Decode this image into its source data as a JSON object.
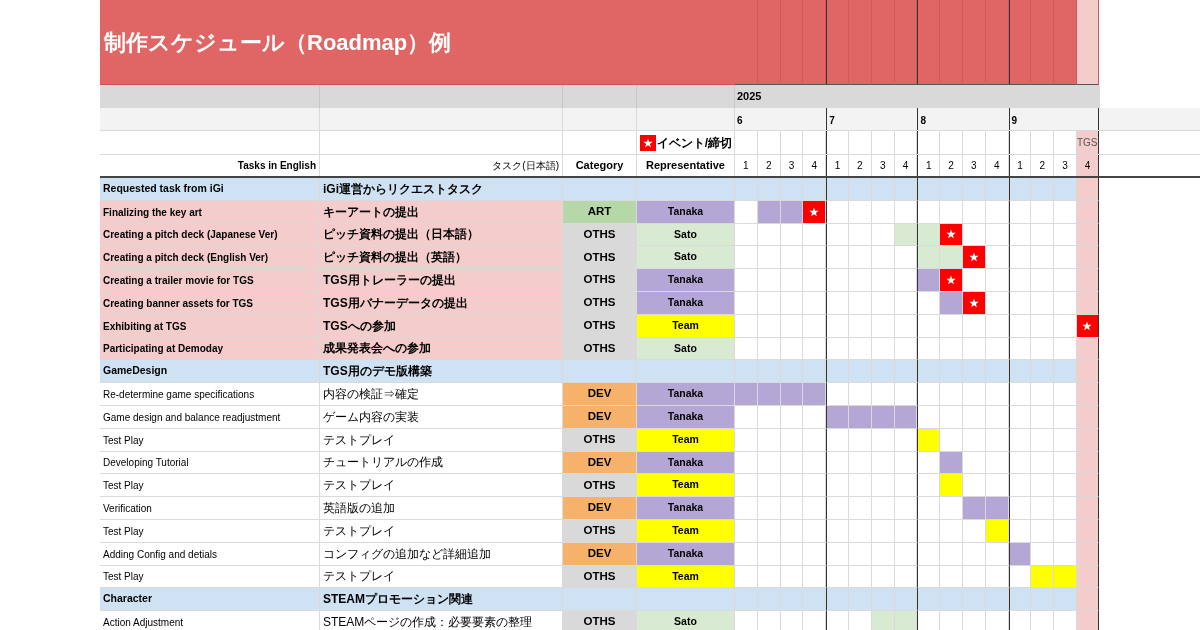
{
  "title": "制作スケジュール（Roadmap）例",
  "year": "2025",
  "legend": {
    "label": "イベント/締切"
  },
  "headers": {
    "english": "Tasks in English",
    "japanese": "タスク(日本語)",
    "category": "Category",
    "representative": "Representative"
  },
  "months": [
    {
      "label": "6",
      "weeks": [
        {
          "label": "1",
          "highlight": false
        },
        {
          "label": "2",
          "highlight": false
        },
        {
          "label": "3",
          "highlight": false
        },
        {
          "label": "4",
          "highlight": false
        }
      ]
    },
    {
      "label": "7",
      "weeks": [
        {
          "label": "1",
          "highlight": false
        },
        {
          "label": "2",
          "highlight": false
        },
        {
          "label": "3",
          "highlight": false
        },
        {
          "label": "4",
          "highlight": false
        }
      ]
    },
    {
      "label": "8",
      "weeks": [
        {
          "label": "1",
          "highlight": false
        },
        {
          "label": "2",
          "highlight": false
        },
        {
          "label": "3",
          "highlight": false
        },
        {
          "label": "4",
          "highlight": false
        }
      ]
    },
    {
      "label": "9",
      "weeks": [
        {
          "label": "1",
          "highlight": false
        },
        {
          "label": "2",
          "highlight": false
        },
        {
          "label": "3",
          "highlight": false
        },
        {
          "label": "4",
          "highlight": true,
          "note": "TGS"
        }
      ]
    }
  ],
  "rows": [
    {
      "kind": "section",
      "english": "Requested task from iGi",
      "japanese": "iGi運営からリクエストタスク",
      "cells": [
        {
          "kind": "none"
        },
        {
          "kind": "none"
        },
        {
          "kind": "none"
        },
        {
          "kind": "none"
        },
        {
          "kind": "none"
        },
        {
          "kind": "none"
        },
        {
          "kind": "none"
        },
        {
          "kind": "none"
        },
        {
          "kind": "none"
        },
        {
          "kind": "none"
        },
        {
          "kind": "none"
        },
        {
          "kind": "none"
        },
        {
          "kind": "none"
        },
        {
          "kind": "none"
        },
        {
          "kind": "none"
        },
        {
          "kind": "none"
        }
      ]
    },
    {
      "kind": "request",
      "english": "Finalizing the key art",
      "japanese": "キーアートの提出",
      "category": {
        "label": "ART",
        "color": "#b6d7a8"
      },
      "representative": {
        "label": "Tanaka",
        "color": "#b4a7d6"
      },
      "cells": [
        {
          "kind": "none"
        },
        {
          "kind": "fill"
        },
        {
          "kind": "fill"
        },
        {
          "kind": "star"
        },
        {
          "kind": "none"
        },
        {
          "kind": "none"
        },
        {
          "kind": "none"
        },
        {
          "kind": "none"
        },
        {
          "kind": "none"
        },
        {
          "kind": "none"
        },
        {
          "kind": "none"
        },
        {
          "kind": "none"
        },
        {
          "kind": "none"
        },
        {
          "kind": "none"
        },
        {
          "kind": "none"
        },
        {
          "kind": "none"
        }
      ]
    },
    {
      "kind": "request",
      "english": "Creating a pitch deck (Japanese Ver)",
      "japanese": "ピッチ資料の提出（日本語）",
      "category": {
        "label": "OTHS",
        "color": "#d9d9d9"
      },
      "representative": {
        "label": "Sato",
        "color": "#d9ead3"
      },
      "cells": [
        {
          "kind": "none"
        },
        {
          "kind": "none"
        },
        {
          "kind": "none"
        },
        {
          "kind": "none"
        },
        {
          "kind": "none"
        },
        {
          "kind": "none"
        },
        {
          "kind": "none"
        },
        {
          "kind": "fill"
        },
        {
          "kind": "fill"
        },
        {
          "kind": "star"
        },
        {
          "kind": "none"
        },
        {
          "kind": "none"
        },
        {
          "kind": "none"
        },
        {
          "kind": "none"
        },
        {
          "kind": "none"
        },
        {
          "kind": "none"
        }
      ]
    },
    {
      "kind": "request",
      "english": "Creating a pitch deck (English Ver)",
      "japanese": "ピッチ資料の提出（英語）",
      "category": {
        "label": "OTHS",
        "color": "#d9d9d9"
      },
      "representative": {
        "label": "Sato",
        "color": "#d9ead3"
      },
      "cells": [
        {
          "kind": "none"
        },
        {
          "kind": "none"
        },
        {
          "kind": "none"
        },
        {
          "kind": "none"
        },
        {
          "kind": "none"
        },
        {
          "kind": "none"
        },
        {
          "kind": "none"
        },
        {
          "kind": "none"
        },
        {
          "kind": "fill"
        },
        {
          "kind": "fill"
        },
        {
          "kind": "star"
        },
        {
          "kind": "none"
        },
        {
          "kind": "none"
        },
        {
          "kind": "none"
        },
        {
          "kind": "none"
        },
        {
          "kind": "none"
        }
      ]
    },
    {
      "kind": "request",
      "english": "Creating a trailer movie  for TGS",
      "japanese": "TGS用トレーラーの提出",
      "category": {
        "label": "OTHS",
        "color": "#d9d9d9"
      },
      "representative": {
        "label": "Tanaka",
        "color": "#b4a7d6"
      },
      "cells": [
        {
          "kind": "none"
        },
        {
          "kind": "none"
        },
        {
          "kind": "none"
        },
        {
          "kind": "none"
        },
        {
          "kind": "none"
        },
        {
          "kind": "none"
        },
        {
          "kind": "none"
        },
        {
          "kind": "none"
        },
        {
          "kind": "fill"
        },
        {
          "kind": "star"
        },
        {
          "kind": "none"
        },
        {
          "kind": "none"
        },
        {
          "kind": "none"
        },
        {
          "kind": "none"
        },
        {
          "kind": "none"
        },
        {
          "kind": "none"
        }
      ]
    },
    {
      "kind": "request",
      "english": "Creating banner assets for TGS",
      "japanese": "TGS用バナーデータの提出",
      "category": {
        "label": "OTHS",
        "color": "#d9d9d9"
      },
      "representative": {
        "label": "Tanaka",
        "color": "#b4a7d6"
      },
      "cells": [
        {
          "kind": "none"
        },
        {
          "kind": "none"
        },
        {
          "kind": "none"
        },
        {
          "kind": "none"
        },
        {
          "kind": "none"
        },
        {
          "kind": "none"
        },
        {
          "kind": "none"
        },
        {
          "kind": "none"
        },
        {
          "kind": "none"
        },
        {
          "kind": "fill"
        },
        {
          "kind": "star"
        },
        {
          "kind": "none"
        },
        {
          "kind": "none"
        },
        {
          "kind": "none"
        },
        {
          "kind": "none"
        },
        {
          "kind": "none"
        }
      ]
    },
    {
      "kind": "request",
      "english": "Exhibiting at TGS",
      "japanese": "TGSへの参加",
      "category": {
        "label": "OTHS",
        "color": "#d9d9d9"
      },
      "representative": {
        "label": "Team",
        "color": "#ffff00"
      },
      "cells": [
        {
          "kind": "none"
        },
        {
          "kind": "none"
        },
        {
          "kind": "none"
        },
        {
          "kind": "none"
        },
        {
          "kind": "none"
        },
        {
          "kind": "none"
        },
        {
          "kind": "none"
        },
        {
          "kind": "none"
        },
        {
          "kind": "none"
        },
        {
          "kind": "none"
        },
        {
          "kind": "none"
        },
        {
          "kind": "none"
        },
        {
          "kind": "none"
        },
        {
          "kind": "none"
        },
        {
          "kind": "none"
        },
        {
          "kind": "star"
        }
      ]
    },
    {
      "kind": "request",
      "english": "Participating at Demoday",
      "japanese": "成果発表会への参加",
      "category": {
        "label": "OTHS",
        "color": "#d9d9d9"
      },
      "representative": {
        "label": "Sato",
        "color": "#d9ead3"
      },
      "cells": [
        {
          "kind": "none"
        },
        {
          "kind": "none"
        },
        {
          "kind": "none"
        },
        {
          "kind": "none"
        },
        {
          "kind": "none"
        },
        {
          "kind": "none"
        },
        {
          "kind": "none"
        },
        {
          "kind": "none"
        },
        {
          "kind": "none"
        },
        {
          "kind": "none"
        },
        {
          "kind": "none"
        },
        {
          "kind": "none"
        },
        {
          "kind": "none"
        },
        {
          "kind": "none"
        },
        {
          "kind": "none"
        },
        {
          "kind": "none"
        }
      ]
    },
    {
      "kind": "section",
      "english": "GameDesign",
      "japanese": "TGS用のデモ版構築",
      "cells": [
        {
          "kind": "none"
        },
        {
          "kind": "none"
        },
        {
          "kind": "none"
        },
        {
          "kind": "none"
        },
        {
          "kind": "none"
        },
        {
          "kind": "none"
        },
        {
          "kind": "none"
        },
        {
          "kind": "none"
        },
        {
          "kind": "none"
        },
        {
          "kind": "none"
        },
        {
          "kind": "none"
        },
        {
          "kind": "none"
        },
        {
          "kind": "none"
        },
        {
          "kind": "none"
        },
        {
          "kind": "none"
        },
        {
          "kind": "none"
        }
      ]
    },
    {
      "kind": "task",
      "english": "Re-determine game specifications",
      "japanese": "内容の検証⇒確定",
      "category": {
        "label": "DEV",
        "color": "#f6b26b"
      },
      "representative": {
        "label": "Tanaka",
        "color": "#b4a7d6"
      },
      "cells": [
        {
          "kind": "fill"
        },
        {
          "kind": "fill"
        },
        {
          "kind": "fill"
        },
        {
          "kind": "fill"
        },
        {
          "kind": "none"
        },
        {
          "kind": "none"
        },
        {
          "kind": "none"
        },
        {
          "kind": "none"
        },
        {
          "kind": "none"
        },
        {
          "kind": "none"
        },
        {
          "kind": "none"
        },
        {
          "kind": "none"
        },
        {
          "kind": "none"
        },
        {
          "kind": "none"
        },
        {
          "kind": "none"
        },
        {
          "kind": "none"
        }
      ]
    },
    {
      "kind": "task",
      "english": "Game design and balance readjustment",
      "japanese": "ゲーム内容の実装",
      "category": {
        "label": "DEV",
        "color": "#f6b26b"
      },
      "representative": {
        "label": "Tanaka",
        "color": "#b4a7d6"
      },
      "cells": [
        {
          "kind": "none"
        },
        {
          "kind": "none"
        },
        {
          "kind": "none"
        },
        {
          "kind": "none"
        },
        {
          "kind": "fill"
        },
        {
          "kind": "fill"
        },
        {
          "kind": "fill"
        },
        {
          "kind": "fill"
        },
        {
          "kind": "none"
        },
        {
          "kind": "none"
        },
        {
          "kind": "none"
        },
        {
          "kind": "none"
        },
        {
          "kind": "none"
        },
        {
          "kind": "none"
        },
        {
          "kind": "none"
        },
        {
          "kind": "none"
        }
      ]
    },
    {
      "kind": "task",
      "english": "Test Play",
      "japanese": "テストプレイ",
      "category": {
        "label": "OTHS",
        "color": "#d9d9d9"
      },
      "representative": {
        "label": "Team",
        "color": "#ffff00"
      },
      "cells": [
        {
          "kind": "none"
        },
        {
          "kind": "none"
        },
        {
          "kind": "none"
        },
        {
          "kind": "none"
        },
        {
          "kind": "none"
        },
        {
          "kind": "none"
        },
        {
          "kind": "none"
        },
        {
          "kind": "none"
        },
        {
          "kind": "fill"
        },
        {
          "kind": "none"
        },
        {
          "kind": "none"
        },
        {
          "kind": "none"
        },
        {
          "kind": "none"
        },
        {
          "kind": "none"
        },
        {
          "kind": "none"
        },
        {
          "kind": "none"
        }
      ]
    },
    {
      "kind": "task",
      "english": "Developing Tutorial",
      "japanese": "チュートリアルの作成",
      "category": {
        "label": "DEV",
        "color": "#f6b26b"
      },
      "representative": {
        "label": "Tanaka",
        "color": "#b4a7d6"
      },
      "cells": [
        {
          "kind": "none"
        },
        {
          "kind": "none"
        },
        {
          "kind": "none"
        },
        {
          "kind": "none"
        },
        {
          "kind": "none"
        },
        {
          "kind": "none"
        },
        {
          "kind": "none"
        },
        {
          "kind": "none"
        },
        {
          "kind": "none"
        },
        {
          "kind": "fill"
        },
        {
          "kind": "none"
        },
        {
          "kind": "none"
        },
        {
          "kind": "none"
        },
        {
          "kind": "none"
        },
        {
          "kind": "none"
        },
        {
          "kind": "none"
        }
      ]
    },
    {
      "kind": "task",
      "english": "Test Play",
      "japanese": "テストプレイ",
      "category": {
        "label": "OTHS",
        "color": "#d9d9d9"
      },
      "representative": {
        "label": "Team",
        "color": "#ffff00"
      },
      "cells": [
        {
          "kind": "none"
        },
        {
          "kind": "none"
        },
        {
          "kind": "none"
        },
        {
          "kind": "none"
        },
        {
          "kind": "none"
        },
        {
          "kind": "none"
        },
        {
          "kind": "none"
        },
        {
          "kind": "none"
        },
        {
          "kind": "none"
        },
        {
          "kind": "fill"
        },
        {
          "kind": "none"
        },
        {
          "kind": "none"
        },
        {
          "kind": "none"
        },
        {
          "kind": "none"
        },
        {
          "kind": "none"
        },
        {
          "kind": "none"
        }
      ]
    },
    {
      "kind": "task",
      "english": "Verification",
      "japanese": "英語版の追加",
      "category": {
        "label": "DEV",
        "color": "#f6b26b"
      },
      "representative": {
        "label": "Tanaka",
        "color": "#b4a7d6"
      },
      "cells": [
        {
          "kind": "none"
        },
        {
          "kind": "none"
        },
        {
          "kind": "none"
        },
        {
          "kind": "none"
        },
        {
          "kind": "none"
        },
        {
          "kind": "none"
        },
        {
          "kind": "none"
        },
        {
          "kind": "none"
        },
        {
          "kind": "none"
        },
        {
          "kind": "none"
        },
        {
          "kind": "fill"
        },
        {
          "kind": "fill"
        },
        {
          "kind": "none"
        },
        {
          "kind": "none"
        },
        {
          "kind": "none"
        },
        {
          "kind": "none"
        }
      ]
    },
    {
      "kind": "task",
      "english": "Test Play",
      "japanese": "テストプレイ",
      "category": {
        "label": "OTHS",
        "color": "#d9d9d9"
      },
      "representative": {
        "label": "Team",
        "color": "#ffff00"
      },
      "cells": [
        {
          "kind": "none"
        },
        {
          "kind": "none"
        },
        {
          "kind": "none"
        },
        {
          "kind": "none"
        },
        {
          "kind": "none"
        },
        {
          "kind": "none"
        },
        {
          "kind": "none"
        },
        {
          "kind": "none"
        },
        {
          "kind": "none"
        },
        {
          "kind": "none"
        },
        {
          "kind": "none"
        },
        {
          "kind": "fill"
        },
        {
          "kind": "none"
        },
        {
          "kind": "none"
        },
        {
          "kind": "none"
        },
        {
          "kind": "none"
        }
      ]
    },
    {
      "kind": "task",
      "english": "Adding Config and detials",
      "japanese": "コンフィグの追加など詳細追加",
      "category": {
        "label": "DEV",
        "color": "#f6b26b"
      },
      "representative": {
        "label": "Tanaka",
        "color": "#b4a7d6"
      },
      "cells": [
        {
          "kind": "none"
        },
        {
          "kind": "none"
        },
        {
          "kind": "none"
        },
        {
          "kind": "none"
        },
        {
          "kind": "none"
        },
        {
          "kind": "none"
        },
        {
          "kind": "none"
        },
        {
          "kind": "none"
        },
        {
          "kind": "none"
        },
        {
          "kind": "none"
        },
        {
          "kind": "none"
        },
        {
          "kind": "none"
        },
        {
          "kind": "fill"
        },
        {
          "kind": "none"
        },
        {
          "kind": "none"
        },
        {
          "kind": "none"
        }
      ]
    },
    {
      "kind": "task",
      "english": "Test Play",
      "japanese": "テストプレイ",
      "category": {
        "label": "OTHS",
        "color": "#d9d9d9"
      },
      "representative": {
        "label": "Team",
        "color": "#ffff00"
      },
      "cells": [
        {
          "kind": "none"
        },
        {
          "kind": "none"
        },
        {
          "kind": "none"
        },
        {
          "kind": "none"
        },
        {
          "kind": "none"
        },
        {
          "kind": "none"
        },
        {
          "kind": "none"
        },
        {
          "kind": "none"
        },
        {
          "kind": "none"
        },
        {
          "kind": "none"
        },
        {
          "kind": "none"
        },
        {
          "kind": "none"
        },
        {
          "kind": "none"
        },
        {
          "kind": "fill"
        },
        {
          "kind": "fill"
        },
        {
          "kind": "none"
        }
      ]
    },
    {
      "kind": "section",
      "english": "Character",
      "japanese": "STEAMプロモーション関連",
      "cells": [
        {
          "kind": "none"
        },
        {
          "kind": "none"
        },
        {
          "kind": "none"
        },
        {
          "kind": "none"
        },
        {
          "kind": "none"
        },
        {
          "kind": "none"
        },
        {
          "kind": "none"
        },
        {
          "kind": "none"
        },
        {
          "kind": "none"
        },
        {
          "kind": "none"
        },
        {
          "kind": "none"
        },
        {
          "kind": "none"
        },
        {
          "kind": "none"
        },
        {
          "kind": "none"
        },
        {
          "kind": "none"
        },
        {
          "kind": "none"
        }
      ]
    },
    {
      "kind": "task",
      "english": "Action Adjustment",
      "japanese": "STEAMページの作成：必要要素の整理",
      "category": {
        "label": "OTHS",
        "color": "#d9d9d9"
      },
      "representative": {
        "label": "Sato",
        "color": "#d9ead3"
      },
      "cells": [
        {
          "kind": "none"
        },
        {
          "kind": "none"
        },
        {
          "kind": "none"
        },
        {
          "kind": "none"
        },
        {
          "kind": "none"
        },
        {
          "kind": "none"
        },
        {
          "kind": "fill"
        },
        {
          "kind": "fill"
        },
        {
          "kind": "none"
        },
        {
          "kind": "none"
        },
        {
          "kind": "none"
        },
        {
          "kind": "none"
        },
        {
          "kind": "none"
        },
        {
          "kind": "none"
        },
        {
          "kind": "none"
        },
        {
          "kind": "none"
        }
      ]
    }
  ]
}
